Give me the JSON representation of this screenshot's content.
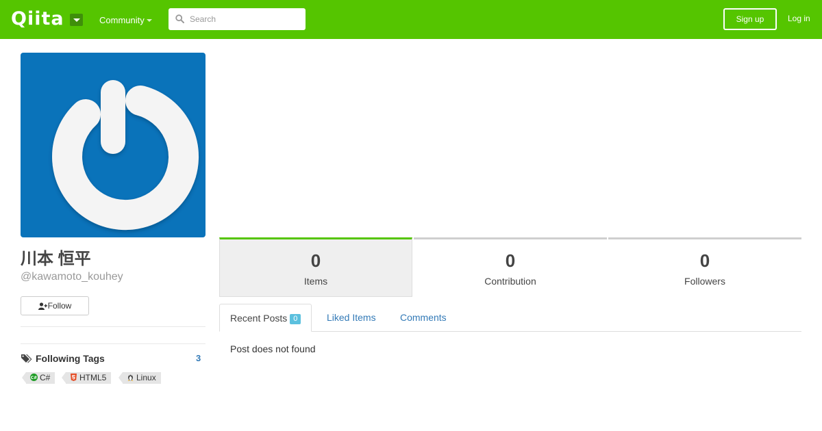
{
  "header": {
    "logo_text": "Qiita",
    "community_label": "Community",
    "search_placeholder": "Search",
    "signup_label": "Sign up",
    "login_label": "Log in"
  },
  "profile": {
    "display_name": "川本 恒平",
    "username": "@kawamoto_kouhey",
    "follow_label": "Follow"
  },
  "following_tags": {
    "title": "Following Tags",
    "count": "3",
    "tags": [
      {
        "name": "C#",
        "icon": "csharp-icon"
      },
      {
        "name": "HTML5",
        "icon": "html5-icon"
      },
      {
        "name": "Linux",
        "icon": "linux-icon"
      }
    ]
  },
  "stats": [
    {
      "value": "0",
      "label": "Items"
    },
    {
      "value": "0",
      "label": "Contribution"
    },
    {
      "value": "0",
      "label": "Followers"
    }
  ],
  "tabs": [
    {
      "label": "Recent Posts",
      "badge": "0"
    },
    {
      "label": "Liked Items"
    },
    {
      "label": "Comments"
    }
  ],
  "empty_message": "Post does not found",
  "colors": {
    "brand": "#55c500",
    "avatar_bg": "#0a73ba",
    "link": "#337ab7",
    "badge": "#5bc0de"
  }
}
